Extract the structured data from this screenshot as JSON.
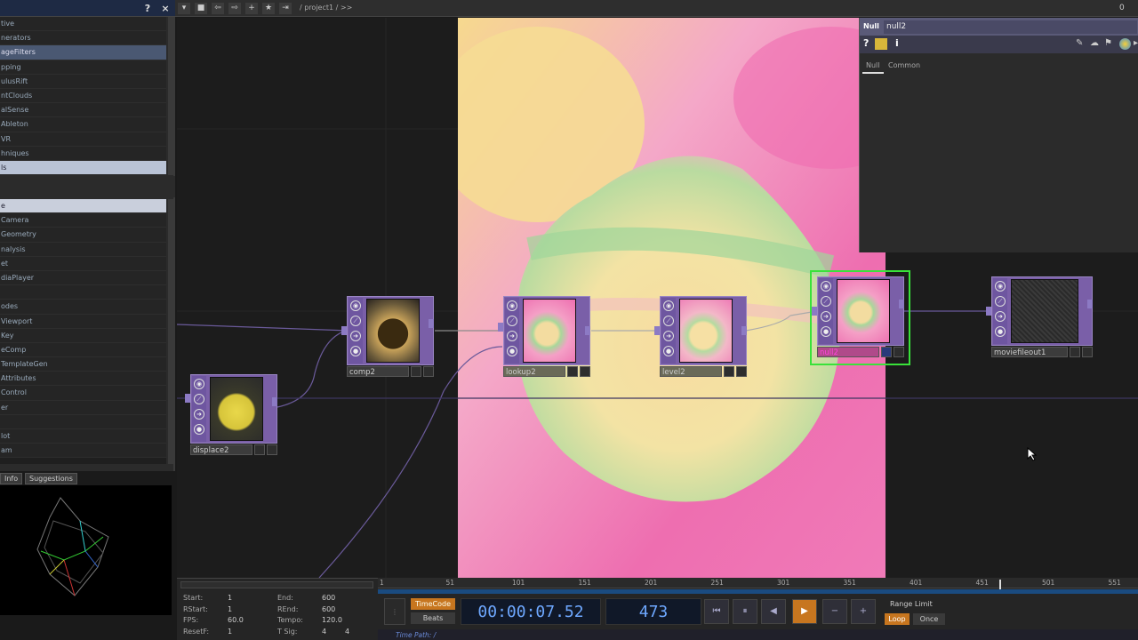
{
  "palette": {
    "header_help": "?",
    "header_close": "×",
    "categories": [
      "tive",
      "nerators",
      "ageFilters",
      "pping",
      "ulusRift",
      "ntClouds",
      "alSense",
      "Ableton",
      "VR",
      "hniques",
      "ls"
    ],
    "items": [
      "e",
      "Camera",
      "Geometry",
      "nalysis",
      "et",
      "diaPlayer",
      "",
      "odes",
      "Viewport",
      "Key",
      "eComp",
      "TemplateGen",
      "Attributes",
      "Control",
      "er",
      "",
      "lot",
      "am"
    ]
  },
  "lower_tabs": {
    "info": "Info",
    "suggestions": "Suggestions"
  },
  "toolbar": {
    "path": "/ project1 / >>",
    "right_value": "0"
  },
  "param_panel": {
    "type": "Null",
    "name": "null2",
    "help": "?",
    "info": "i",
    "tabs": [
      "Null",
      "Common"
    ]
  },
  "nodes": {
    "comp2": "comp2",
    "lookup2": "lookup2",
    "level2": "level2",
    "null2": "null2",
    "moviefileout1": "moviefileout1",
    "displace2": "displace2"
  },
  "timeline": {
    "ruler": [
      "1",
      "51",
      "101",
      "151",
      "201",
      "251",
      "301",
      "351",
      "401",
      "451",
      "501",
      "551"
    ],
    "fields_left": [
      {
        "label": "Start:",
        "value": "1"
      },
      {
        "label": "RStart:",
        "value": "1"
      },
      {
        "label": "FPS:",
        "value": "60.0"
      },
      {
        "label": "ResetF:",
        "value": "1"
      }
    ],
    "fields_right": [
      {
        "label": "End:",
        "value": "600"
      },
      {
        "label": "REnd:",
        "value": "600"
      },
      {
        "label": "Tempo:",
        "value": "120.0"
      },
      {
        "label": "T Sig:",
        "value": "4",
        "value2": "4"
      }
    ],
    "timecode_btn": "TimeCode",
    "beats_btn": "Beats",
    "timecode": "00:00:07.52",
    "frame": "473",
    "range_limit": "Range Limit",
    "loop": "Loop",
    "once": "Once",
    "time_path": "Time Path: /"
  },
  "colors": {
    "accent_orange": "#c7761f",
    "node_purple": "#7a5fa8",
    "select_green": "#39e23a",
    "timecode_blue": "#6ea8ff"
  }
}
